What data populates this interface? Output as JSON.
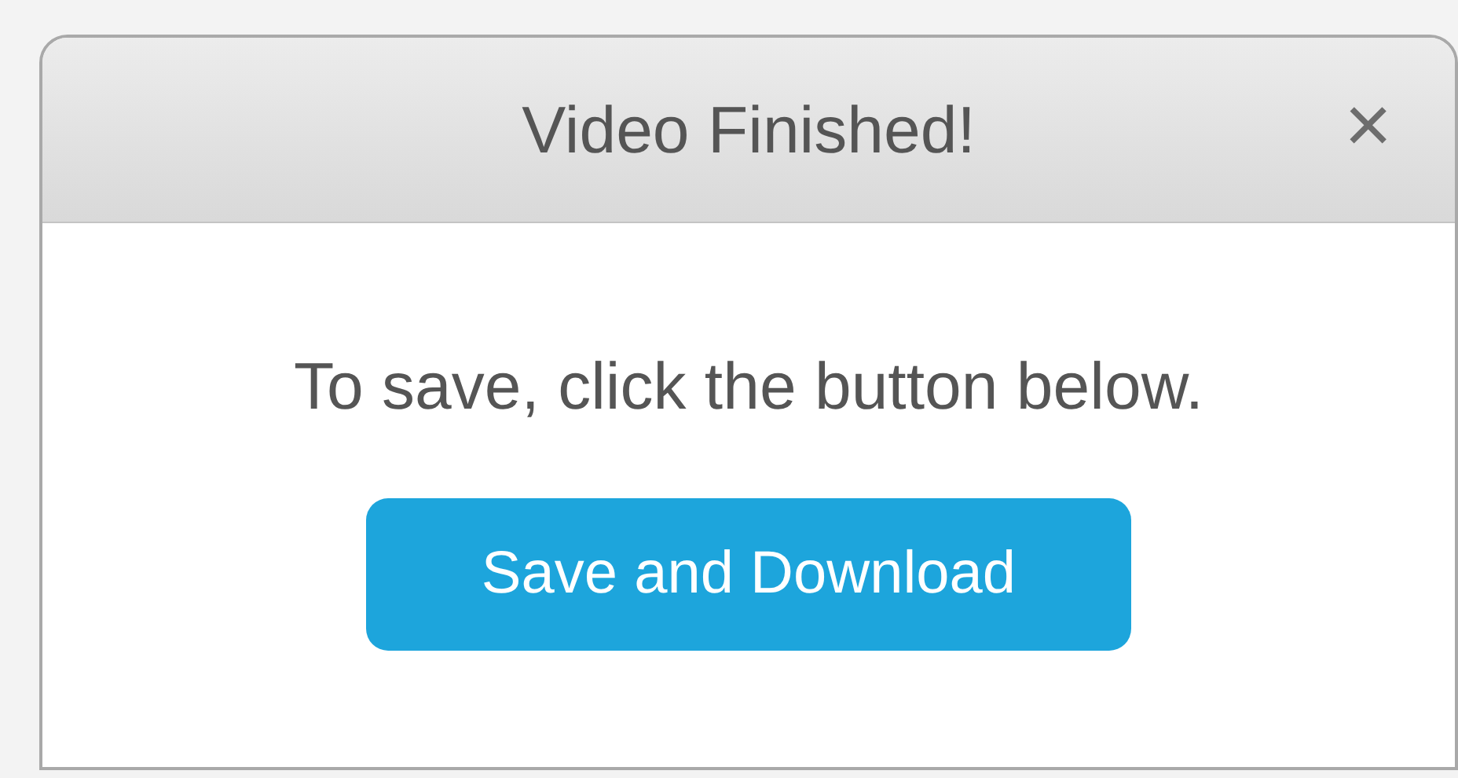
{
  "dialog": {
    "title": "Video Finished!",
    "close": "×",
    "message": "To save, click the button below.",
    "button": "Save and Download"
  }
}
